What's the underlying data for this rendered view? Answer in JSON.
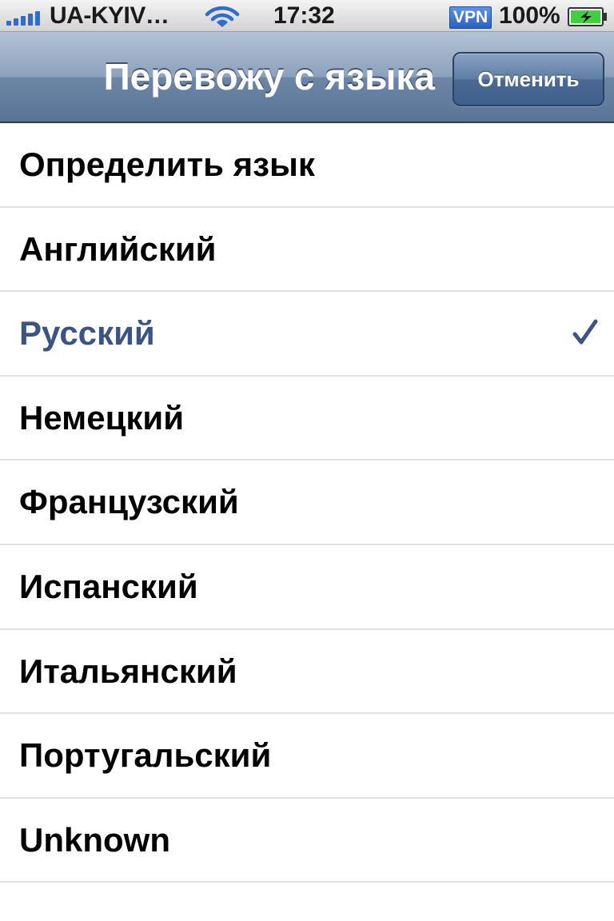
{
  "status_bar": {
    "carrier": "UA-KYIV…",
    "time": "17:32",
    "vpn_label": "VPN",
    "battery_percent": "100%",
    "signal_bars": 5,
    "icons": [
      "signal-strength-icon",
      "wifi-icon",
      "battery-charging-icon"
    ]
  },
  "nav_bar": {
    "title": "Перевожу с языка",
    "cancel_label": "Отменить"
  },
  "language_list": {
    "items": [
      {
        "label": "Определить язык",
        "selected": false
      },
      {
        "label": "Английский",
        "selected": false
      },
      {
        "label": "Русский",
        "selected": true
      },
      {
        "label": "Немецкий",
        "selected": false
      },
      {
        "label": "Французский",
        "selected": false
      },
      {
        "label": "Испанский",
        "selected": false
      },
      {
        "label": "Итальянский",
        "selected": false
      },
      {
        "label": "Португальский",
        "selected": false
      },
      {
        "label": "Unknown",
        "selected": false
      }
    ],
    "check_icon": "checkmark-icon"
  },
  "colors": {
    "nav_bar_blue": "#6d86a6",
    "selected_text": "#3a5486",
    "signal_blue": "#2f6ed0",
    "battery_green": "#3fcf3f"
  }
}
